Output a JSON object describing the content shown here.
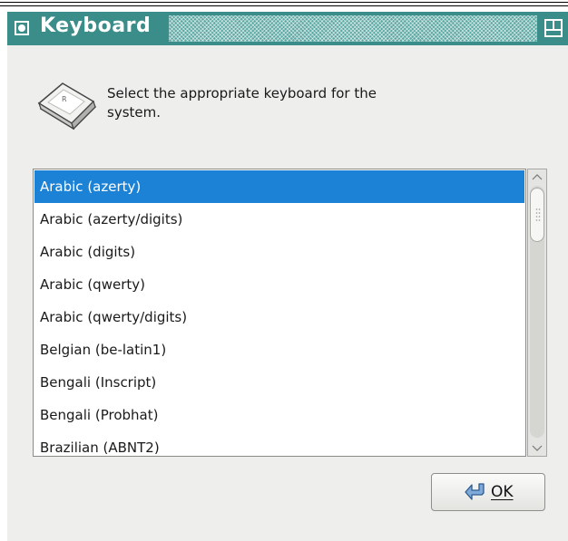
{
  "window": {
    "title": "Keyboard"
  },
  "prompt": {
    "text": "Select the appropriate keyboard for the system."
  },
  "keyboard_list": {
    "items": [
      {
        "label": "Arabic (azerty)",
        "selected": true
      },
      {
        "label": "Arabic (azerty/digits)",
        "selected": false
      },
      {
        "label": "Arabic (digits)",
        "selected": false
      },
      {
        "label": "Arabic (qwerty)",
        "selected": false
      },
      {
        "label": "Arabic (qwerty/digits)",
        "selected": false
      },
      {
        "label": "Belgian (be-latin1)",
        "selected": false
      },
      {
        "label": "Bengali (Inscript)",
        "selected": false
      },
      {
        "label": "Bengali (Probhat)",
        "selected": false
      },
      {
        "label": "Brazilian (ABNT2)",
        "selected": false
      }
    ]
  },
  "buttons": {
    "ok_label": "OK",
    "ok_icon": "enter-arrow-icon"
  },
  "colors": {
    "titlebar": "#3b8d89",
    "selection": "#1c82d5",
    "dialog_bg": "#eeeeec"
  }
}
